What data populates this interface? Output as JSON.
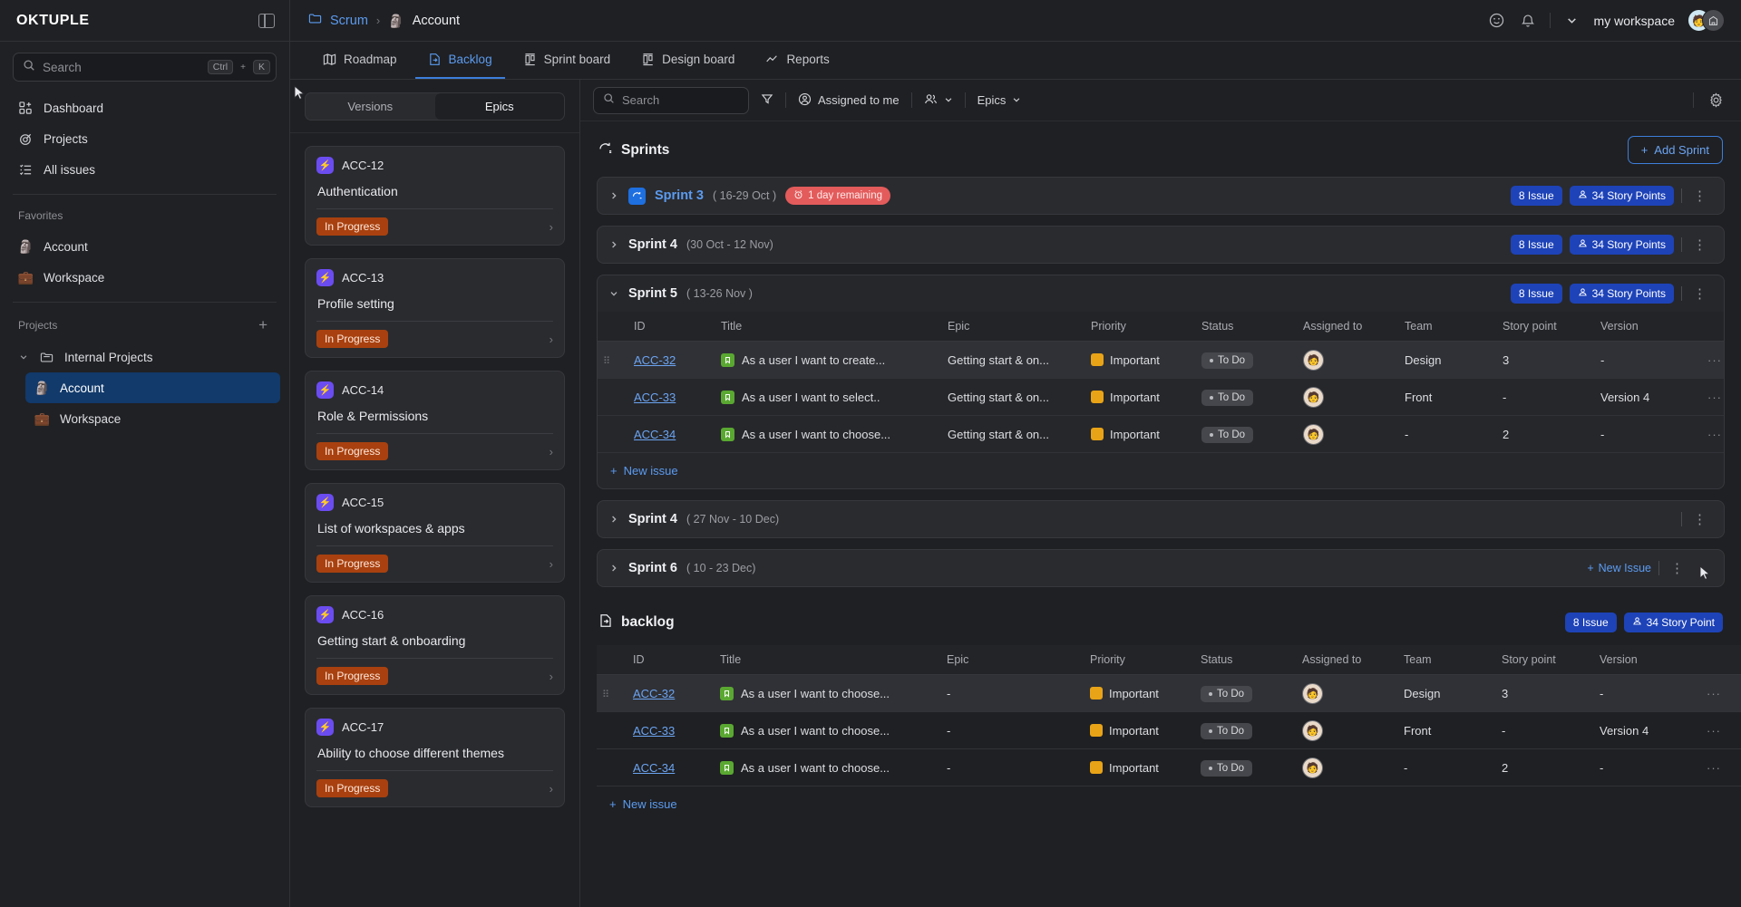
{
  "brand": {
    "name": "OKTUPLE",
    "panel_icon": "panel-collapse-icon"
  },
  "sidebar": {
    "search": {
      "placeholder": "Search",
      "kbd_ctrl": "Ctrl",
      "kbd_sep": "+",
      "kbd_key": "K"
    },
    "nav": [
      {
        "label": "Dashboard",
        "icon": "dashboard-icon"
      },
      {
        "label": "Projects",
        "icon": "target-icon"
      },
      {
        "label": "All issues",
        "icon": "list-check-icon"
      }
    ],
    "favorites_label": "Favorites",
    "favorites": [
      {
        "label": "Account",
        "icon": "moai-emoji"
      },
      {
        "label": "Workspace",
        "icon": "briefcase-emoji"
      }
    ],
    "projects_label": "Projects",
    "projects_add": "+",
    "project_group": {
      "label": "Internal Projects",
      "icon": "folder-icon"
    },
    "project_items": [
      {
        "label": "Account",
        "icon": "moai-emoji",
        "active": true
      },
      {
        "label": "Workspace",
        "icon": "briefcase-emoji",
        "active": false
      }
    ]
  },
  "topbar": {
    "breadcrumb_root": "Scrum",
    "breadcrumb_sep": "›",
    "breadcrumb_current": "Account",
    "workspace": "my workspace",
    "chevron": "⌄"
  },
  "tabs": [
    {
      "label": "Roadmap",
      "icon": "map-icon",
      "active": false
    },
    {
      "label": "Backlog",
      "icon": "backlog-icon",
      "active": true
    },
    {
      "label": "Sprint board",
      "icon": "board-icon",
      "active": false
    },
    {
      "label": "Design board",
      "icon": "board-icon",
      "active": false
    },
    {
      "label": "Reports",
      "icon": "chart-icon",
      "active": false
    }
  ],
  "epics_panel": {
    "segments": [
      {
        "label": "Versions",
        "active": false
      },
      {
        "label": "Epics",
        "active": true
      }
    ],
    "cards": [
      {
        "id": "ACC-12",
        "title": "Authentication",
        "status": "In Progress"
      },
      {
        "id": "ACC-13",
        "title": "Profile setting",
        "status": "In Progress"
      },
      {
        "id": "ACC-14",
        "title": "Role & Permissions",
        "status": "In Progress"
      },
      {
        "id": "ACC-15",
        "title": "List of workspaces & apps",
        "status": "In Progress"
      },
      {
        "id": "ACC-16",
        "title": "Getting start & onboarding",
        "status": "In Progress"
      },
      {
        "id": "ACC-17",
        "title": "Ability to choose different themes",
        "status": "In Progress"
      }
    ]
  },
  "filterbar": {
    "search_placeholder": "Search",
    "filter_icon": "funnel-icon",
    "assigned_to_me": "Assigned to me",
    "people_icon": "people-icon",
    "epics_label": "Epics",
    "gear_icon": "gear-icon"
  },
  "sprints_section": {
    "title": "Sprints",
    "add_sprint": "Add Sprint",
    "issue_pill": "8 Issue",
    "points_pill": "34 Story Points",
    "sprints": [
      {
        "name": "Sprint 3",
        "dates": "( 16-29 Oct )",
        "expanded": false,
        "highlighted": true,
        "warning": "1 day remaining",
        "show_badges": true
      },
      {
        "name": "Sprint 4",
        "dates": "(30 Oct - 12 Nov)",
        "expanded": false,
        "highlighted": false,
        "warning": "",
        "show_badges": true
      },
      {
        "name": "Sprint 5",
        "dates": "( 13-26 Nov )",
        "expanded": true,
        "highlighted": false,
        "warning": "",
        "show_badges": true
      },
      {
        "name": "Sprint 4",
        "dates": "( 27 Nov - 10 Dec)",
        "expanded": false,
        "highlighted": false,
        "warning": "",
        "show_badges": false
      },
      {
        "name": "Sprint 6",
        "dates": "( 10 - 23 Dec)",
        "expanded": false,
        "highlighted": false,
        "warning": "",
        "show_badges": false,
        "new_issue": "New Issue"
      }
    ]
  },
  "table_headers": [
    "ID",
    "Title",
    "Epic",
    "Priority",
    "Status",
    "Assigned to",
    "Team",
    "Story point",
    "Version"
  ],
  "sprint5_rows": [
    {
      "id": "ACC-32",
      "title": "As a user I want to create...",
      "epic": "Getting start & on...",
      "priority": "Important",
      "status": "To Do",
      "team": "Design",
      "story_point": "3",
      "version": "-",
      "highlighted": true
    },
    {
      "id": "ACC-33",
      "title": "As a user I want to select..",
      "epic": "Getting start & on...",
      "priority": "Important",
      "status": "To Do",
      "team": "Front",
      "story_point": "-",
      "version": "Version 4",
      "highlighted": false
    },
    {
      "id": "ACC-34",
      "title": "As a user I want to choose...",
      "epic": "Getting start & on...",
      "priority": "Important",
      "status": "To Do",
      "team": "-",
      "story_point": "2",
      "version": "-",
      "highlighted": false
    }
  ],
  "new_issue_label": "New issue",
  "backlog_section": {
    "title": "backlog",
    "issue_pill": "8 Issue",
    "points_pill": "34 Story Point",
    "rows": [
      {
        "id": "ACC-32",
        "title": "As a user I want to choose...",
        "epic": "-",
        "priority": "Important",
        "status": "To Do",
        "team": "Design",
        "story_point": "3",
        "version": "-",
        "highlighted": true
      },
      {
        "id": "ACC-33",
        "title": "As a user I want to choose...",
        "epic": "-",
        "priority": "Important",
        "status": "To Do",
        "team": "Front",
        "story_point": "-",
        "version": "Version 4",
        "highlighted": false
      },
      {
        "id": "ACC-34",
        "title": "As a user I want to choose...",
        "epic": "-",
        "priority": "Important",
        "status": "To Do",
        "team": "-",
        "story_point": "2",
        "version": "-",
        "highlighted": false
      }
    ]
  },
  "colors": {
    "accent_blue": "#5b9bf0",
    "pill_blue": "#1e43b8",
    "danger_red": "#e35b5b",
    "epic_purple": "#6b4cf0",
    "progress_orange": "#a8410f",
    "story_green": "#5aa832",
    "priority_yellow": "#e8a317"
  }
}
